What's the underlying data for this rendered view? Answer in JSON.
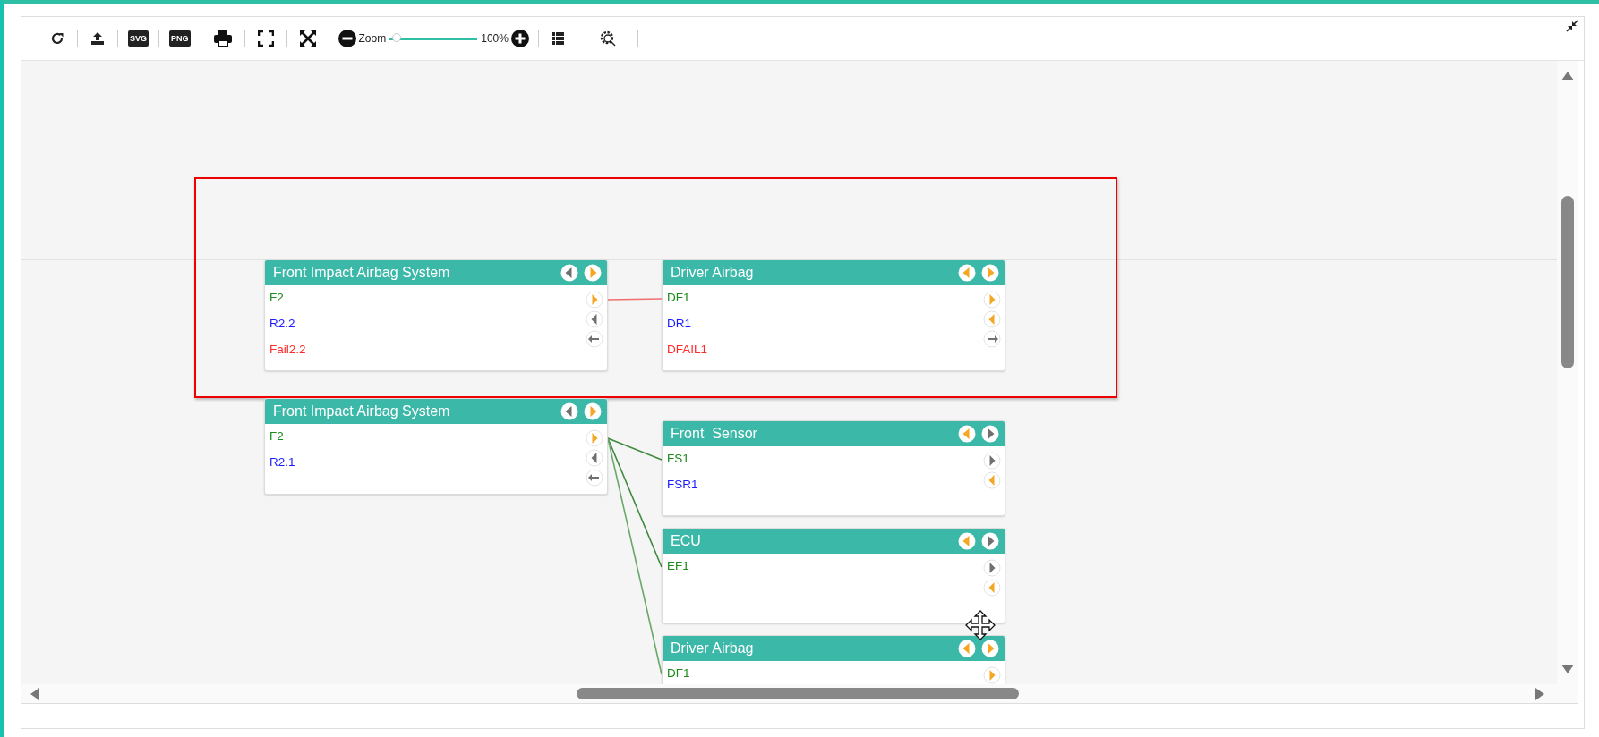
{
  "toolbar": [
    {
      "kind": "refresh"
    },
    {
      "kind": "upload"
    },
    {
      "kind": "svg",
      "label": "SVG"
    },
    {
      "kind": "png",
      "label": "PNG"
    },
    {
      "kind": "print"
    },
    {
      "kind": "fullscreen"
    },
    {
      "kind": "fit"
    },
    {
      "kind": "zoom",
      "label": "Zoom",
      "level": 0.08,
      "reading": "100%"
    },
    {
      "kind": "grid"
    },
    {
      "kind": "inspect"
    }
  ],
  "nodes": [
    {
      "title": "Front Impact Airbag System",
      "buttons": [
        {
          "kind": "left",
          "color": "#707070"
        },
        {
          "kind": "right",
          "color": "#f5a623"
        }
      ],
      "rows": [
        {
          "label": "F2",
          "color": "#1a8a1a"
        },
        {
          "label": "R2.2",
          "color": "#1a1aff"
        },
        {
          "label": "Fail2.2",
          "color": "#ff2a2a"
        }
      ],
      "ports": [
        {
          "kind": "right",
          "color": "#f5a623"
        },
        {
          "kind": "left",
          "color": "#707070"
        },
        {
          "kind": "arrow-left",
          "color": "#707070"
        }
      ]
    },
    {
      "title": "Driver Airbag",
      "buttons": [
        {
          "kind": "left",
          "color": "#f5a623"
        },
        {
          "kind": "right",
          "color": "#f5a623"
        }
      ],
      "rows": [
        {
          "label": "DF1",
          "color": "#1a8a1a"
        },
        {
          "label": "DR1",
          "color": "#1a1aff"
        },
        {
          "label": "DFAIL1",
          "color": "#ff2a2a"
        }
      ],
      "ports": [
        {
          "kind": "right",
          "color": "#f5a623"
        },
        {
          "kind": "left",
          "color": "#f5a623"
        },
        {
          "kind": "arrow-right",
          "color": "#707070"
        }
      ]
    },
    {
      "title": "Front Impact Airbag System",
      "buttons": [
        {
          "kind": "left",
          "color": "#707070"
        },
        {
          "kind": "right",
          "color": "#f5a623"
        }
      ],
      "rows": [
        {
          "label": "F2",
          "color": "#1a8a1a"
        },
        {
          "label": "R2.1",
          "color": "#1a1aff"
        }
      ],
      "ports": [
        {
          "kind": "right",
          "color": "#f5a623"
        },
        {
          "kind": "left",
          "color": "#707070"
        },
        {
          "kind": "arrow-left",
          "color": "#707070"
        }
      ]
    },
    {
      "title": "Front  Sensor",
      "buttons": [
        {
          "kind": "left",
          "color": "#f5a623"
        },
        {
          "kind": "right",
          "color": "#707070"
        }
      ],
      "rows": [
        {
          "label": "FS1",
          "color": "#1a8a1a"
        },
        {
          "label": "FSR1",
          "color": "#1a1aff"
        }
      ],
      "ports": [
        {
          "kind": "right",
          "color": "#707070"
        },
        {
          "kind": "left",
          "color": "#f5a623"
        }
      ]
    },
    {
      "title": "ECU",
      "buttons": [
        {
          "kind": "left",
          "color": "#f5a623"
        },
        {
          "kind": "right",
          "color": "#707070"
        }
      ],
      "rows": [
        {
          "label": "EF1",
          "color": "#1a8a1a"
        }
      ],
      "ports": [
        {
          "kind": "right",
          "color": "#707070"
        },
        {
          "kind": "left",
          "color": "#f5a623"
        }
      ]
    },
    {
      "title": "Driver Airbag",
      "buttons": [
        {
          "kind": "left",
          "color": "#f5a623"
        },
        {
          "kind": "right",
          "color": "#f5a623"
        }
      ],
      "rows": [
        {
          "label": "DF1",
          "color": "#1a8a1a"
        }
      ],
      "ports": [
        {
          "kind": "right",
          "color": "#f5a623"
        }
      ]
    }
  ],
  "connections": [
    {
      "color": "#f07070"
    },
    {
      "color": "#3f8a3f"
    },
    {
      "color": "#3f8a3f"
    },
    {
      "color": "#6aa86a"
    }
  ]
}
